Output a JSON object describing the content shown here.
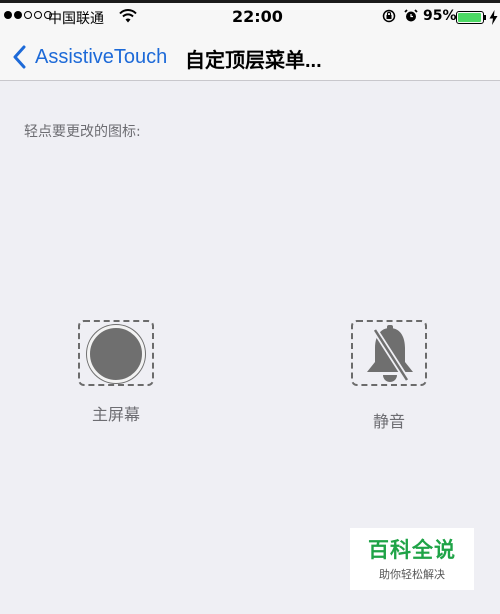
{
  "status_bar": {
    "carrier": "中国联通",
    "time": "22:00",
    "battery_percent": "95%",
    "battery_level": 0.95,
    "signal_bars_filled": 2,
    "signal_bars_total": 5
  },
  "nav": {
    "back_label": "AssistiveTouch",
    "title": "自定顶层菜单..."
  },
  "section": {
    "header": "轻点要更改的图标:"
  },
  "icons": [
    {
      "label": "主屏幕",
      "icon": "home-button-icon"
    },
    {
      "label": "静音",
      "icon": "bell-slash-icon"
    }
  ],
  "watermark": {
    "title": "百科全说",
    "subtitle": "助你轻松解决"
  },
  "colors": {
    "accent": "#1d6ad8",
    "background": "#efeff4",
    "battery": "#4cd964",
    "watermark_green": "#1fa347"
  }
}
